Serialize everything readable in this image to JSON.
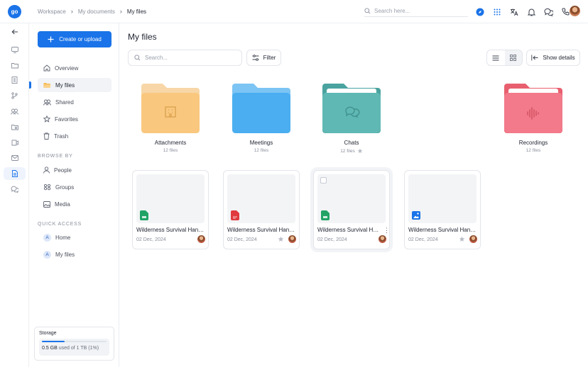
{
  "app": {
    "logo_text": "go"
  },
  "breadcrumb": [
    "Workspace",
    "My documents",
    "My files"
  ],
  "top_search": {
    "placeholder": "Search here..."
  },
  "sidebar": {
    "create_label": "Create or upload",
    "nav": [
      {
        "label": "Overview",
        "icon": "home-icon"
      },
      {
        "label": "My files",
        "icon": "folder-icon",
        "active": true
      },
      {
        "label": "Shared",
        "icon": "users-icon"
      },
      {
        "label": "Favorites",
        "icon": "star-icon"
      },
      {
        "label": "Trash",
        "icon": "trash-icon"
      }
    ],
    "browse_title": "BROWSE BY",
    "browse": [
      {
        "label": "People",
        "icon": "person-icon"
      },
      {
        "label": "Groups",
        "icon": "groups-icon"
      },
      {
        "label": "Media",
        "icon": "image-icon"
      }
    ],
    "quick_title": "QUICK ACCESS",
    "quick": [
      {
        "label": "Home",
        "badge": "A"
      },
      {
        "label": "My files",
        "badge": "A"
      }
    ],
    "storage": {
      "title": "Storage",
      "used": "0.5 GB",
      "rest": "used of 1 TB (1%)",
      "percent": 0.35
    }
  },
  "main": {
    "title": "My files",
    "search_placeholder": "Search...",
    "filter_label": "Filter",
    "details_label": "Show details",
    "folders": [
      {
        "name": "Attachments",
        "meta": "12 files",
        "color": "#f9c77e"
      },
      {
        "name": "Meetings",
        "meta": "12 files",
        "color": "#4aaef0"
      },
      {
        "name": "Chats",
        "meta": "12 files",
        "color": "#5fb8b4",
        "starred": true
      },
      {
        "name": "Recordings",
        "meta": "12 files",
        "color": "#f27a8a"
      }
    ],
    "files": [
      {
        "name": "Wilderness Survival Handbook",
        "date": "02 Dec, 2024",
        "type": "sheet",
        "color": "#21a366"
      },
      {
        "name": "Wilderness Survival Handbook",
        "date": "02 Dec, 2024",
        "type": "pdf",
        "color": "#e0393e"
      },
      {
        "name": "Wilderness Survival Handbook",
        "date": "02 Dec, 2024",
        "type": "sheet",
        "color": "#21a366"
      },
      {
        "name": "Wilderness Survival Handbook",
        "date": "02 Dec, 2024",
        "type": "image",
        "color": "#1a73e8"
      }
    ]
  }
}
